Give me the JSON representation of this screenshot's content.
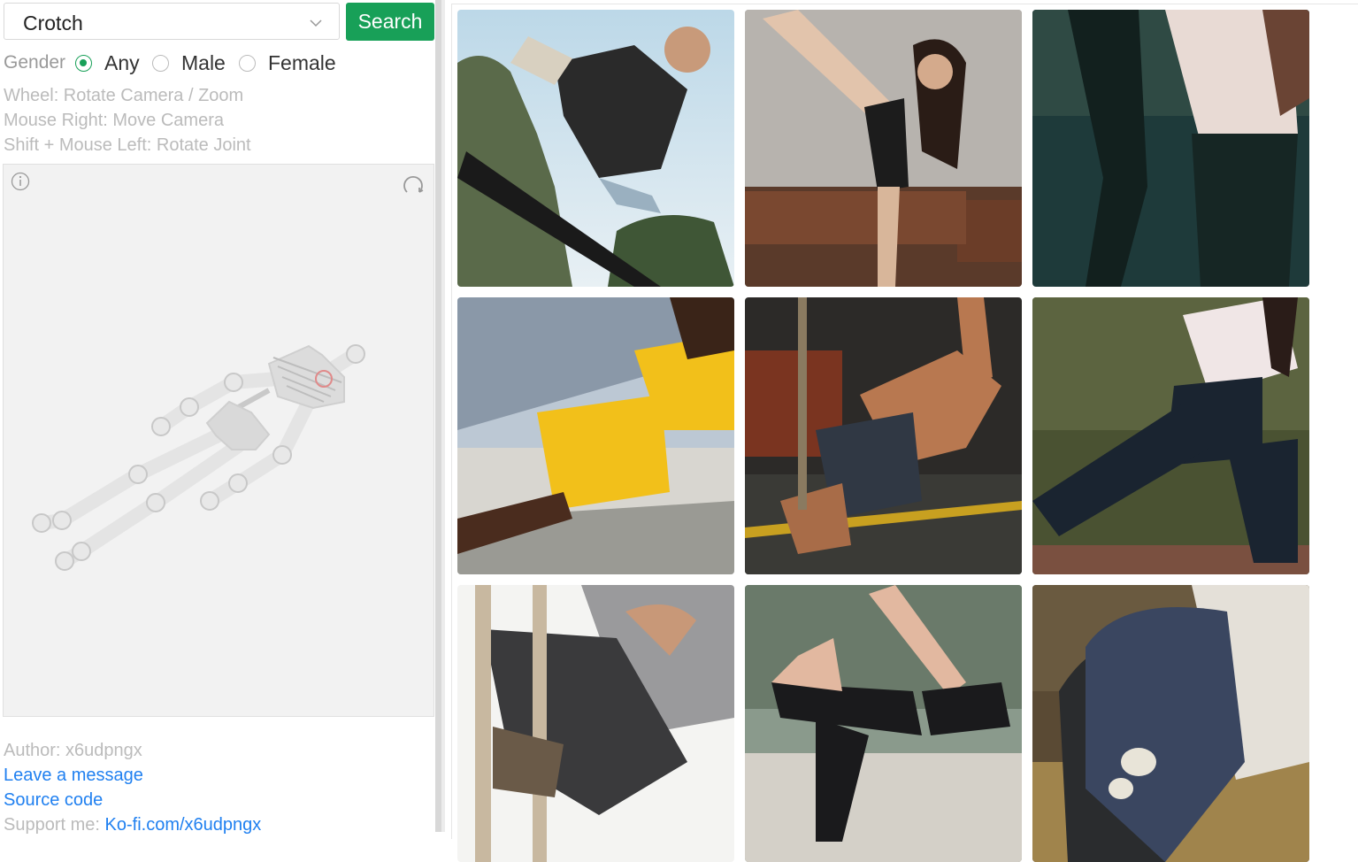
{
  "search": {
    "joint_select_value": "Crotch",
    "button_label": "Search"
  },
  "gender": {
    "label": "Gender",
    "options": [
      "Any",
      "Male",
      "Female"
    ],
    "selected": "Any"
  },
  "hints": [
    "Wheel: Rotate Camera / Zoom",
    "Mouse Right: Move Camera",
    "Shift + Mouse Left: Rotate Joint"
  ],
  "viewport": {
    "info_icon": "info-icon",
    "reset_icon": "reset-view-icon"
  },
  "footer": {
    "author": "Author: x6udpngx",
    "leave_message": "Leave a message",
    "source_code": "Source code",
    "support_label": "Support me:",
    "support_link": "Ko-fi.com/x6udpngx"
  },
  "colors": {
    "accent": "#18a058",
    "link": "#2080f0",
    "muted_text": "#bbbbbb",
    "canvas_bg": "#f2f2f2"
  },
  "results": [
    {
      "subject": "skateboarder mid-air ollie"
    },
    {
      "subject": "woman high kick in living room"
    },
    {
      "subject": "woman high leg kick outdoors"
    },
    {
      "subject": "woman in yellow outfit side plank"
    },
    {
      "subject": "shirtless man side plank in gym"
    },
    {
      "subject": "woman lunge stretch in forest"
    },
    {
      "subject": "man hanging on pole bars"
    },
    {
      "subject": "woman yoga dancer pose on beach"
    },
    {
      "subject": "skateboarder holding board"
    }
  ]
}
